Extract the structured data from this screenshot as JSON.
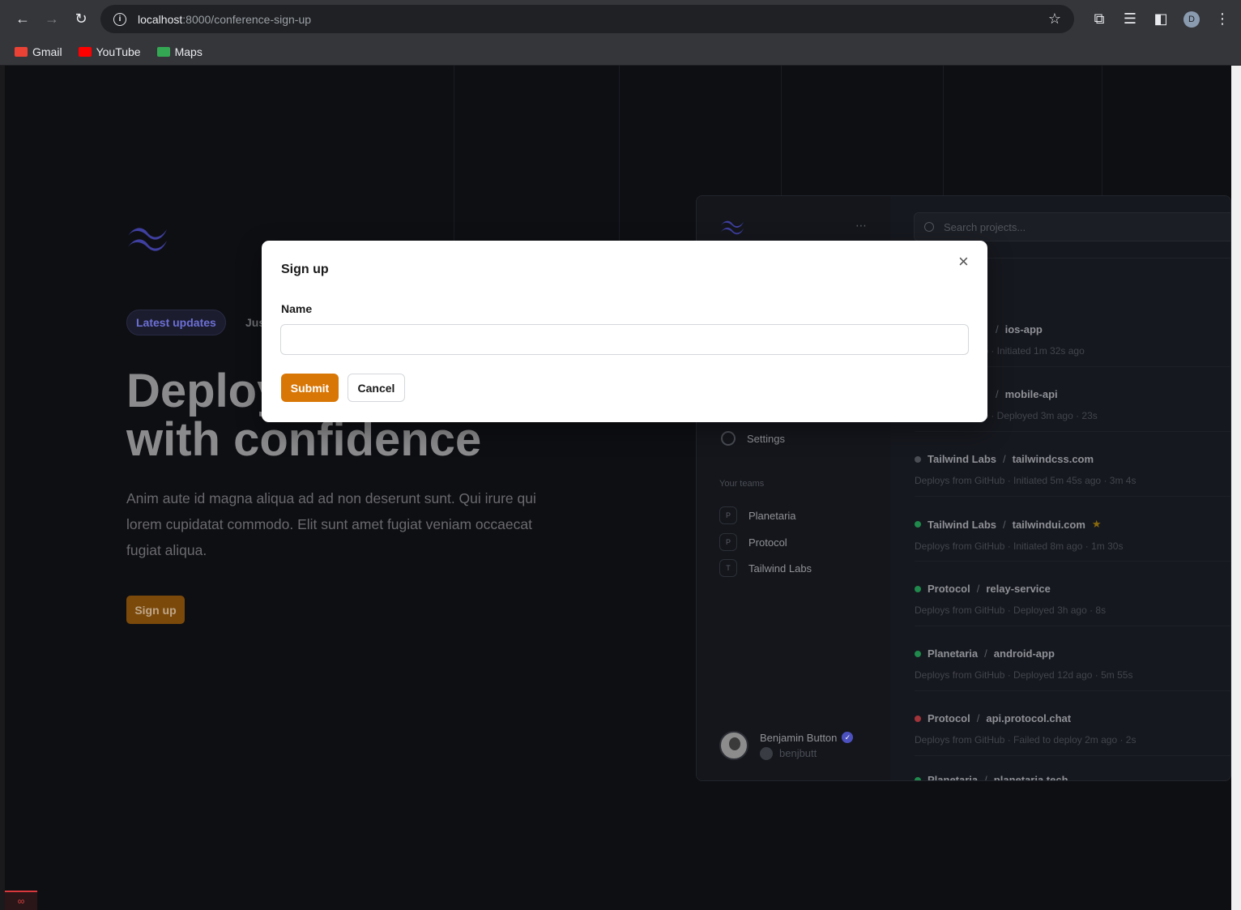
{
  "browser": {
    "url_host": "localhost",
    "url_path": ":8000/conference-sign-up",
    "profile_initial": "D",
    "bookmarks": [
      {
        "label": "Gmail",
        "color": "#ea4335"
      },
      {
        "label": "YouTube",
        "color": "#ff0000"
      },
      {
        "label": "Maps",
        "color": "#34a853"
      }
    ]
  },
  "hero": {
    "pill": "Latest updates",
    "pill_side": "Jus",
    "title_line1": "Deploy",
    "title_line2": "with confidence",
    "description": "Anim aute id magna aliqua ad ad non deserunt sunt. Qui irure qui lorem cupidatat commodo. Elit sunt amet fugiat veniam occaecat fugiat aliqua.",
    "cta": "Sign up"
  },
  "app": {
    "search_placeholder": "Search projects...",
    "settings": "Settings",
    "teams_heading": "Your teams",
    "teams": [
      {
        "initial": "P",
        "name": "Planetaria"
      },
      {
        "initial": "P",
        "name": "Protocol"
      },
      {
        "initial": "T",
        "name": "Tailwind Labs"
      }
    ],
    "user": {
      "name": "Benjamin Button",
      "handle": "benjbutt"
    },
    "deployments": [
      {
        "team": "",
        "project": "ios-app",
        "sub": "Hub  ·  Initiated 1m 32s ago",
        "status": "#555"
      },
      {
        "team": "",
        "project": "mobile-api",
        "sub": "Hub  ·  Deployed 3m ago  ·  23s",
        "status": "#555"
      },
      {
        "team": "Tailwind Labs",
        "project": "tailwindcss.com",
        "sub": "Deploys from GitHub  ·  Initiated 5m 45s ago  ·  3m 4s",
        "status": "#4b4d55"
      },
      {
        "team": "Tailwind Labs",
        "project": "tailwindui.com",
        "sub": "Deploys from GitHub  ·  Initiated 8m ago  ·  1m 30s",
        "status": "#1f8a4c"
      },
      {
        "team": "Protocol",
        "project": "relay-service",
        "sub": "Deploys from GitHub  ·  Deployed 3h ago  ·  8s",
        "status": "#1f8a4c"
      },
      {
        "team": "Planetaria",
        "project": "android-app",
        "sub": "Deploys from GitHub  ·  Deployed 12d ago  ·  5m 55s",
        "status": "#1f8a4c"
      },
      {
        "team": "Protocol",
        "project": "api.protocol.chat",
        "sub": "Deploys from GitHub  ·  Failed to deploy 2m ago  ·  2s",
        "status": "#a3343a"
      },
      {
        "team": "Planetaria",
        "project": "planetaria.tech",
        "sub": "",
        "status": "#1f8a4c"
      }
    ]
  },
  "modal": {
    "title": "Sign up",
    "field_label": "Name",
    "field_value": "",
    "submit": "Submit",
    "cancel": "Cancel"
  }
}
